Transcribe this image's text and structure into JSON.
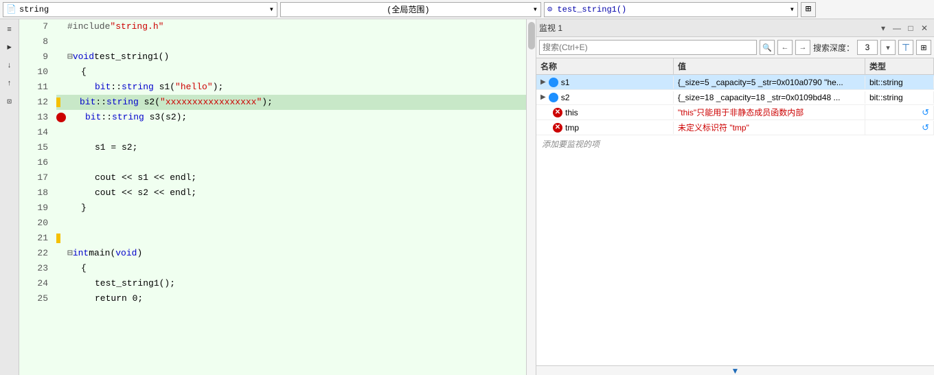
{
  "topbar": {
    "filename": "string",
    "scope": "(全局范围)",
    "function": "⊙ test_string1()",
    "split_btn": "⊞"
  },
  "sidebar": {
    "icons": [
      "≡",
      "►",
      "↓",
      "↑",
      "⊡"
    ]
  },
  "code": {
    "lines": [
      {
        "num": "7",
        "indent": 0,
        "content": "#include \"string.h\"",
        "type": "include"
      },
      {
        "num": "8",
        "indent": 0,
        "content": "",
        "type": "empty"
      },
      {
        "num": "9",
        "indent": 0,
        "content": "⊟void test_string1()",
        "type": "function-def"
      },
      {
        "num": "10",
        "indent": 1,
        "content": "{",
        "type": "brace"
      },
      {
        "num": "11",
        "indent": 2,
        "content": "bit::string s1(\"hello\");",
        "type": "code"
      },
      {
        "num": "12",
        "indent": 2,
        "content": "bit::string s2(\"xxxxxxxxxxxxxxxxx\");",
        "type": "code",
        "has_breakpoint": false,
        "highlighted": true
      },
      {
        "num": "13",
        "indent": 2,
        "content": "bit::string s3(s2);",
        "type": "code",
        "has_breakpoint": true
      },
      {
        "num": "14",
        "indent": 0,
        "content": "",
        "type": "empty"
      },
      {
        "num": "15",
        "indent": 2,
        "content": "s1 = s2;",
        "type": "code"
      },
      {
        "num": "16",
        "indent": 0,
        "content": "",
        "type": "empty"
      },
      {
        "num": "17",
        "indent": 2,
        "content": "cout << s1 << endl;",
        "type": "code"
      },
      {
        "num": "18",
        "indent": 2,
        "content": "cout << s2 << endl;",
        "type": "code"
      },
      {
        "num": "19",
        "indent": 1,
        "content": "}",
        "type": "brace"
      },
      {
        "num": "20",
        "indent": 0,
        "content": "",
        "type": "empty"
      },
      {
        "num": "21",
        "indent": 0,
        "content": "",
        "type": "empty-marker"
      },
      {
        "num": "22",
        "indent": 0,
        "content": "⊟int main(void)",
        "type": "function-def"
      },
      {
        "num": "23",
        "indent": 1,
        "content": "{",
        "type": "brace"
      },
      {
        "num": "24",
        "indent": 2,
        "content": "test_string1();",
        "type": "code"
      },
      {
        "num": "25",
        "indent": 2,
        "content": "return 0;",
        "type": "code-partial"
      }
    ]
  },
  "watch": {
    "title": "监视 1",
    "search_placeholder": "搜索(Ctrl+E)",
    "depth_label": "搜索深度：",
    "depth_value": "3",
    "columns": {
      "name": "名称",
      "value": "值",
      "type": "类型"
    },
    "rows": [
      {
        "name": "s1",
        "value": "{_size=5 _capacity=5 _str=0x010a0790 \"he...",
        "type": "bit::string",
        "status": "blue",
        "expanded": false,
        "selected": true,
        "has_refresh": false
      },
      {
        "name": "s2",
        "value": "{_size=18 _capacity=18 _str=0x0109bd48 ...",
        "type": "bit::string",
        "status": "blue",
        "expanded": false,
        "selected": false,
        "has_refresh": false
      },
      {
        "name": "this",
        "value": "\"this\"只能用于非静态成员函数内部",
        "type": "",
        "status": "error",
        "expanded": false,
        "selected": false,
        "has_refresh": true
      },
      {
        "name": "tmp",
        "value": "未定义标识符 \"tmp\"",
        "type": "",
        "status": "error",
        "expanded": false,
        "selected": false,
        "has_refresh": true
      }
    ],
    "add_watch_label": "添加要监视的项"
  }
}
